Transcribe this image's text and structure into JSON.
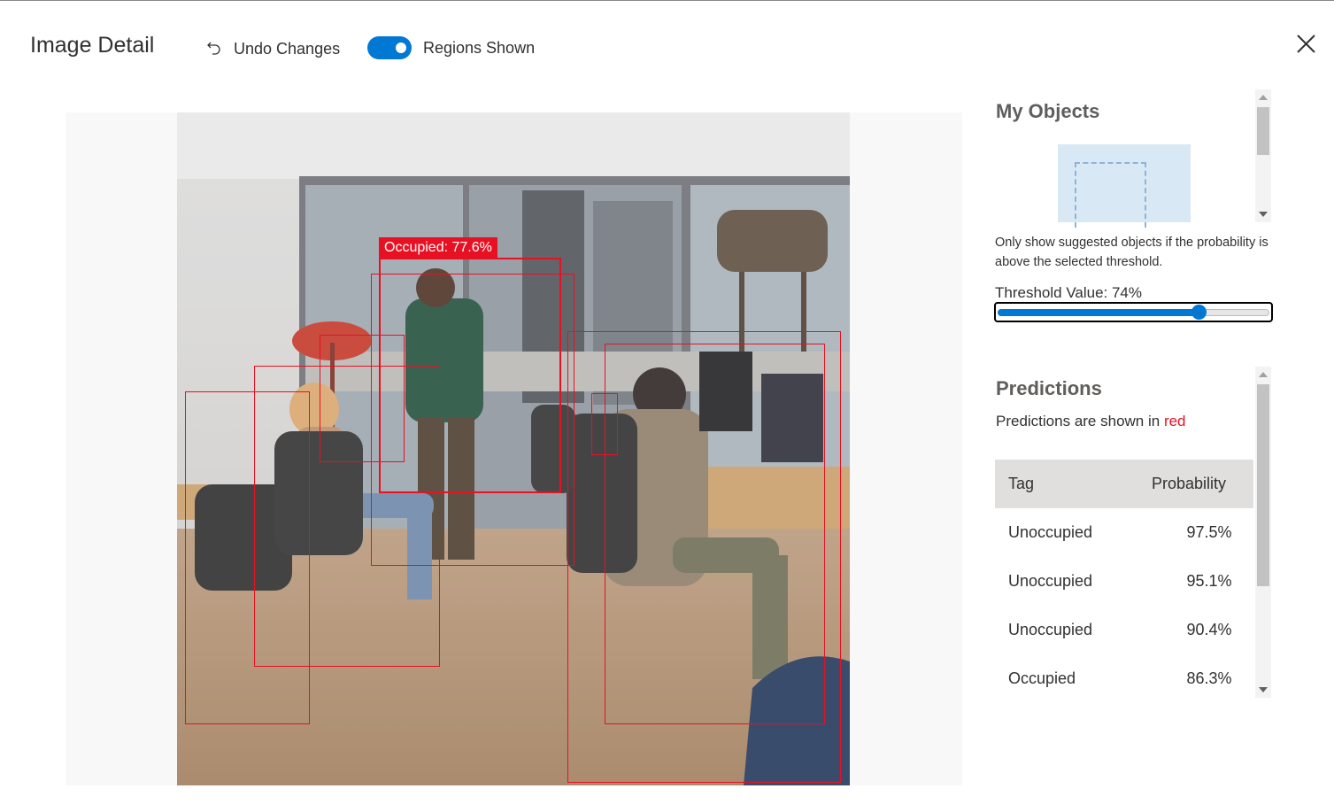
{
  "header": {
    "title": "Image Detail",
    "undo_label": "Undo Changes",
    "regions_label": "Regions Shown",
    "regions_on": true
  },
  "viewer": {
    "label": "Occupied: 77.6%"
  },
  "objects": {
    "title": "My Objects"
  },
  "threshold": {
    "help": "Only show suggested objects if the probability is above the selected threshold.",
    "label": "Threshold Value: 74%",
    "value": 0.74
  },
  "predictions": {
    "title": "Predictions",
    "note_prefix": "Predictions are shown in ",
    "note_color_word": "red",
    "headers": {
      "tag": "Tag",
      "probability": "Probability"
    },
    "rows": [
      {
        "tag": "Unoccupied",
        "probability": "97.5%"
      },
      {
        "tag": "Unoccupied",
        "probability": "95.1%"
      },
      {
        "tag": "Unoccupied",
        "probability": "90.4%"
      },
      {
        "tag": "Occupied",
        "probability": "86.3%"
      }
    ]
  },
  "colors": {
    "accent": "#0078d4",
    "prediction": "#e81123"
  }
}
